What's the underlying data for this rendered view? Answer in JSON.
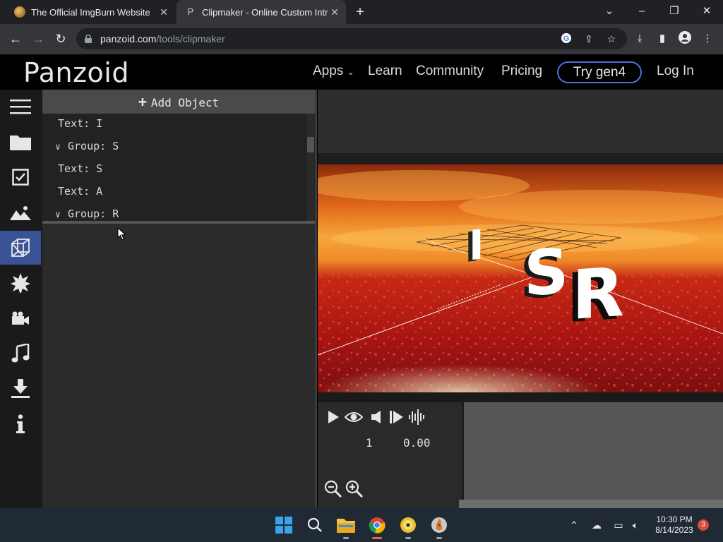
{
  "browser": {
    "tabs": [
      {
        "title": "The Official ImgBurn Website",
        "active": false
      },
      {
        "title": "Clipmaker - Online Custom Intro",
        "active": true
      }
    ],
    "new_tab_icon": "plus-icon",
    "url_host": "panzoid.com",
    "url_path": "/tools/clipmaker"
  },
  "site": {
    "logo": "Panzoid",
    "nav": {
      "apps": "Apps",
      "learn": "Learn",
      "community": "Community",
      "pricing": "Pricing",
      "try": "Try gen4",
      "login": "Log In"
    },
    "accent_color": "#4f6ed8"
  },
  "rail": {
    "items": [
      "menu-icon",
      "folder-icon",
      "checkbox-icon",
      "image-icon",
      "cube-icon",
      "burst-icon",
      "camera-icon",
      "music-icon",
      "download-icon",
      "info-icon"
    ],
    "active_item": "cube-icon",
    "active_color": "#3a5296"
  },
  "panel": {
    "add_object": "Add Object",
    "tree": [
      {
        "label": "Text: I",
        "type": "text"
      },
      {
        "label": "Group: S",
        "type": "group"
      },
      {
        "label": "Text: S",
        "type": "text"
      },
      {
        "label": "Text: A",
        "type": "text"
      },
      {
        "label": "Group: R",
        "type": "group"
      }
    ]
  },
  "preview": {
    "scene_letters": [
      "I",
      "S",
      "R"
    ]
  },
  "playback": {
    "frame": "1",
    "time": "0.00",
    "controls": [
      "play-icon",
      "eye-icon",
      "volume-icon",
      "step-forward-icon",
      "waveform-icon"
    ],
    "zoom": [
      "zoom-out-icon",
      "zoom-in-icon"
    ]
  },
  "taskbar": {
    "time": "10:30 PM",
    "date": "8/14/2023",
    "notification_count": "3"
  }
}
